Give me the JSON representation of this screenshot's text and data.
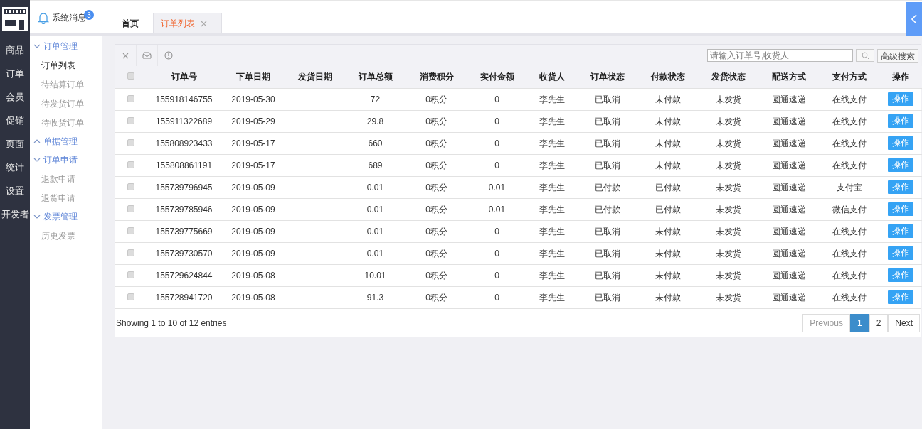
{
  "nav_rail": {
    "items": [
      {
        "label": "商品",
        "selected": false
      },
      {
        "label": "订单",
        "selected": false
      },
      {
        "label": "会员",
        "selected": false
      },
      {
        "label": "促销",
        "selected": false
      },
      {
        "label": "页面",
        "selected": false
      },
      {
        "label": "统计",
        "selected": false
      },
      {
        "label": "设置",
        "selected": false
      },
      {
        "label": "开发者",
        "selected": false
      }
    ]
  },
  "notifications": {
    "label": "系统消息",
    "count": "3"
  },
  "tabs": [
    {
      "label": "首页",
      "selected": false,
      "closable": false
    },
    {
      "label": "订单列表",
      "selected": true,
      "closable": true
    }
  ],
  "sidebar": {
    "groups": [
      {
        "label": "订单管理",
        "expanded": true,
        "children": [
          {
            "label": "订单列表",
            "selected": true
          },
          {
            "label": "待结算订单",
            "selected": false
          },
          {
            "label": "待发货订单",
            "selected": false
          },
          {
            "label": "待收货订单",
            "selected": false
          }
        ]
      },
      {
        "label": "单据管理",
        "expanded": false
      },
      {
        "label": "订单申请",
        "expanded": true,
        "children": [
          {
            "label": "退款申请",
            "selected": false
          },
          {
            "label": "退货申请",
            "selected": false
          }
        ]
      },
      {
        "label": "发票管理",
        "expanded": true,
        "children": [
          {
            "label": "历史发票",
            "selected": false
          }
        ]
      }
    ]
  },
  "search": {
    "placeholder": "请输入订单号,收货人",
    "advanced_button": "高级搜索"
  },
  "table": {
    "columns": [
      "订单号",
      "下单日期",
      "发货日期",
      "订单总额",
      "消费积分",
      "实付金额",
      "收货人",
      "订单状态",
      "付款状态",
      "发货状态",
      "配送方式",
      "支付方式",
      "操作"
    ],
    "header_checked": false,
    "rows": [
      {
        "checked": false,
        "cells": [
          "155918146755",
          "2019-05-30",
          "",
          "72",
          "0积分",
          "0",
          "李先生",
          "已取消",
          "未付款",
          "未发货",
          "圆通速递",
          "在线支付"
        ],
        "action": "操作"
      },
      {
        "checked": false,
        "cells": [
          "155911322689",
          "2019-05-29",
          "",
          "29.8",
          "0积分",
          "0",
          "李先生",
          "已取消",
          "未付款",
          "未发货",
          "圆通速递",
          "在线支付"
        ],
        "action": "操作"
      },
      {
        "checked": false,
        "cells": [
          "155808923433",
          "2019-05-17",
          "",
          "660",
          "0积分",
          "0",
          "李先生",
          "已取消",
          "未付款",
          "未发货",
          "圆通速递",
          "在线支付"
        ],
        "action": "操作"
      },
      {
        "checked": false,
        "cells": [
          "155808861191",
          "2019-05-17",
          "",
          "689",
          "0积分",
          "0",
          "李先生",
          "已取消",
          "未付款",
          "未发货",
          "圆通速递",
          "在线支付"
        ],
        "action": "操作"
      },
      {
        "checked": false,
        "cells": [
          "155739796945",
          "2019-05-09",
          "",
          "0.01",
          "0积分",
          "0.01",
          "李先生",
          "已付款",
          "已付款",
          "未发货",
          "圆通速递",
          "支付宝"
        ],
        "action": "操作"
      },
      {
        "checked": false,
        "cells": [
          "155739785946",
          "2019-05-09",
          "",
          "0.01",
          "0积分",
          "0.01",
          "李先生",
          "已付款",
          "已付款",
          "未发货",
          "圆通速递",
          "微信支付"
        ],
        "action": "操作"
      },
      {
        "checked": false,
        "cells": [
          "155739775669",
          "2019-05-09",
          "",
          "0.01",
          "0积分",
          "0",
          "李先生",
          "已取消",
          "未付款",
          "未发货",
          "圆通速递",
          "在线支付"
        ],
        "action": "操作"
      },
      {
        "checked": false,
        "cells": [
          "155739730570",
          "2019-05-09",
          "",
          "0.01",
          "0积分",
          "0",
          "李先生",
          "已取消",
          "未付款",
          "未发货",
          "圆通速递",
          "在线支付"
        ],
        "action": "操作"
      },
      {
        "checked": false,
        "cells": [
          "155729624844",
          "2019-05-08",
          "",
          "10.01",
          "0积分",
          "0",
          "李先生",
          "已取消",
          "未付款",
          "未发货",
          "圆通速递",
          "在线支付"
        ],
        "action": "操作"
      },
      {
        "checked": false,
        "cells": [
          "155728941720",
          "2019-05-08",
          "",
          "91.3",
          "0积分",
          "0",
          "李先生",
          "已取消",
          "未付款",
          "未发货",
          "圆通速递",
          "在线支付"
        ],
        "action": "操作"
      }
    ]
  },
  "footer": {
    "info": "Showing 1 to 10 of 12 entries"
  },
  "pagination": [
    {
      "label": "Previous",
      "disabled": true,
      "selected": false
    },
    {
      "label": "1",
      "disabled": false,
      "selected": true
    },
    {
      "label": "2",
      "disabled": false,
      "selected": false
    },
    {
      "label": "Next",
      "disabled": false,
      "selected": false
    }
  ]
}
